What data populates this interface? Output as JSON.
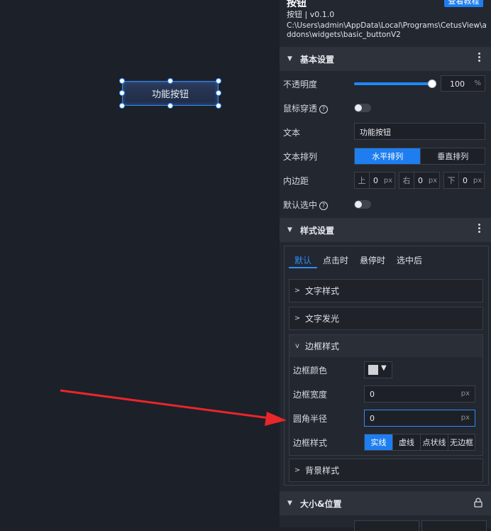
{
  "canvas": {
    "widget_label": "功能按钮"
  },
  "panel": {
    "title": "按钮",
    "version": "按钮 | v0.1.0",
    "path": "C:\\Users\\admin\\AppData\\Local\\Programs\\CetusView\\addons\\widgets\\basic_buttonV2",
    "tutorial_button": "查看教程"
  },
  "basic": {
    "section": "基本设置",
    "opacity_label": "不透明度",
    "opacity_value": "100",
    "opacity_unit": "%",
    "opacity_level": 100,
    "mouse_through_label": "鼠标穿透",
    "text_label": "文本",
    "text_value": "功能按钮",
    "text_layout_label": "文本排列",
    "layout_options": [
      "水平排列",
      "垂直排列"
    ],
    "padding_label": "内边距",
    "padding": [
      {
        "side": "上",
        "value": "0",
        "unit": "px"
      },
      {
        "side": "右",
        "value": "0",
        "unit": "px"
      },
      {
        "side": "下",
        "value": "0",
        "unit": "px"
      }
    ],
    "default_selected_label": "默认选中"
  },
  "style": {
    "section": "样式设置",
    "tabs": [
      "默认",
      "点击时",
      "悬停时",
      "选中后"
    ],
    "text_style": "文字样式",
    "text_glow": "文字发光",
    "border_style": "边框样式",
    "border_color_label": "边框颜色",
    "border_color": "#cfd2d6",
    "border_width_label": "边框宽度",
    "border_width_value": "0",
    "border_radius_label": "圆角半径",
    "border_radius_value": "0",
    "unit": "px",
    "border_style_label": "边框样式",
    "border_style_options": [
      "实线",
      "虚线",
      "点状线",
      "无边框"
    ],
    "background_style": "背景样式"
  },
  "size_pos": {
    "section": "大小&位置"
  },
  "colors": {
    "accent": "#1e7ef0",
    "annotation_arrow": "#e8262b"
  }
}
